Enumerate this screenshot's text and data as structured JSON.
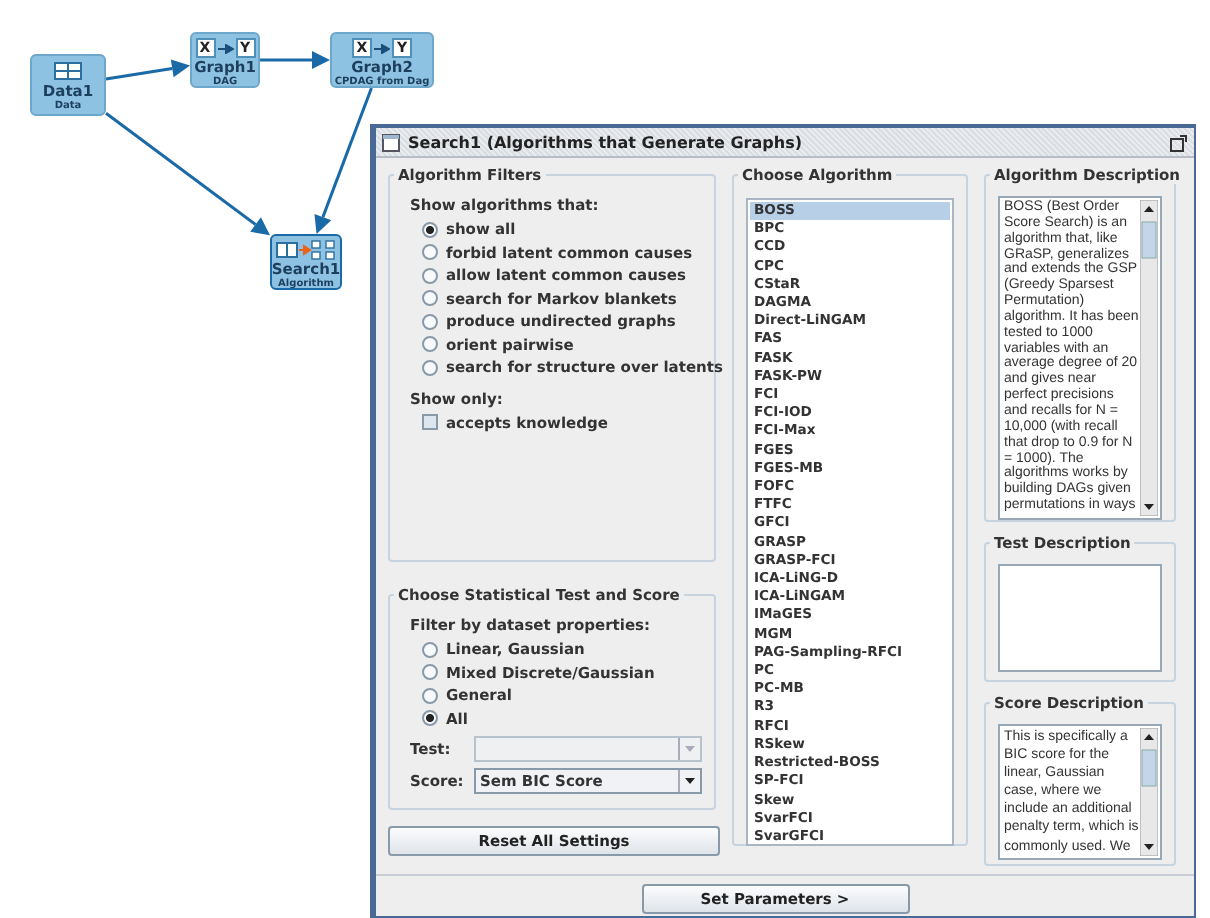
{
  "canvas": {
    "nodes": [
      {
        "name": "Data1",
        "type": "Data",
        "kind": "data"
      },
      {
        "name": "Graph1",
        "type": "DAG",
        "kind": "graph",
        "icon_text": [
          "X",
          "Y"
        ]
      },
      {
        "name": "Graph2",
        "type": "CPDAG from Dag",
        "kind": "graph",
        "icon_text": [
          "X",
          "Y"
        ]
      },
      {
        "name": "Search1",
        "type": "Algorithm",
        "kind": "search",
        "selected": true
      }
    ]
  },
  "dialog": {
    "title": "Search1 (Algorithms that Generate Graphs)",
    "algorithm_filters": {
      "title": "Algorithm Filters",
      "show_label": "Show algorithms that:",
      "options": [
        {
          "label": "show all",
          "selected": true
        },
        {
          "label": "forbid latent common causes",
          "selected": false
        },
        {
          "label": "allow latent common causes",
          "selected": false
        },
        {
          "label": "search for Markov blankets",
          "selected": false
        },
        {
          "label": "produce undirected graphs",
          "selected": false
        },
        {
          "label": "orient pairwise",
          "selected": false
        },
        {
          "label": "search for structure over latents",
          "selected": false
        }
      ],
      "show_only_label": "Show only:",
      "checkboxes": [
        {
          "label": "accepts knowledge",
          "checked": false
        }
      ]
    },
    "test_score": {
      "title": "Choose Statistical Test and Score",
      "filter_label": "Filter by dataset properties:",
      "options": [
        {
          "label": "Linear, Gaussian",
          "selected": false
        },
        {
          "label": "Mixed Discrete/Gaussian",
          "selected": false
        },
        {
          "label": "General",
          "selected": false
        },
        {
          "label": "All",
          "selected": true
        }
      ],
      "test": {
        "label": "Test:",
        "disabled": true
      },
      "score": {
        "label": "Score:",
        "value": "Sem BIC Score",
        "disabled": false
      }
    },
    "reset_button": "Reset All Settings",
    "algorithms": {
      "title": "Choose Algorithm",
      "items": [
        {
          "label": "BOSS",
          "selected": true
        },
        {
          "label": "BPC",
          "selected": false
        },
        {
          "label": "CCD",
          "selected": false
        },
        {
          "label": "CPC",
          "selected": false
        },
        {
          "label": "CStaR",
          "selected": false
        },
        {
          "label": "DAGMA",
          "selected": false
        },
        {
          "label": "Direct-LiNGAM",
          "selected": false
        },
        {
          "label": "FAS",
          "selected": false
        },
        {
          "label": "FASK",
          "selected": false
        },
        {
          "label": "FASK-PW",
          "selected": false
        },
        {
          "label": "FCI",
          "selected": false
        },
        {
          "label": "FCI-IOD",
          "selected": false
        },
        {
          "label": "FCI-Max",
          "selected": false
        },
        {
          "label": "FGES",
          "selected": false
        },
        {
          "label": "FGES-MB",
          "selected": false
        },
        {
          "label": "FOFC",
          "selected": false
        },
        {
          "label": "FTFC",
          "selected": false
        },
        {
          "label": "GFCI",
          "selected": false
        },
        {
          "label": "GRASP",
          "selected": false
        },
        {
          "label": "GRASP-FCI",
          "selected": false
        },
        {
          "label": "ICA-LiNG-D",
          "selected": false
        },
        {
          "label": "ICA-LiNGAM",
          "selected": false
        },
        {
          "label": "IMaGES",
          "selected": false
        },
        {
          "label": "MGM",
          "selected": false
        },
        {
          "label": "PAG-Sampling-RFCI",
          "selected": false
        },
        {
          "label": "PC",
          "selected": false
        },
        {
          "label": "PC-MB",
          "selected": false
        },
        {
          "label": "R3",
          "selected": false
        },
        {
          "label": "RFCI",
          "selected": false
        },
        {
          "label": "RSkew",
          "selected": false
        },
        {
          "label": "Restricted-BOSS",
          "selected": false
        },
        {
          "label": "SP-FCI",
          "selected": false
        },
        {
          "label": "Skew",
          "selected": false
        },
        {
          "label": "SvarFCI",
          "selected": false
        },
        {
          "label": "SvarGFCI",
          "selected": false
        }
      ]
    },
    "algorithm_description": {
      "title": "Algorithm Description",
      "lines": [
        "BOSS (Best Order",
        "Score Search) is an",
        "algorithm that, like",
        "GRaSP, generalizes",
        "and extends the GSP",
        "(Greedy Sparsest",
        "Permutation)",
        "algorithm. It has been",
        "tested to 1000",
        "variables with an",
        "average degree of 20",
        "and gives near",
        "perfect precisions",
        "and recalls for N =",
        "10,000 (with recall",
        "that drop to 0.9 for N",
        "= 1000). The",
        "algorithms works by",
        "building DAGs given",
        "permutations in ways"
      ]
    },
    "test_description": {
      "title": "Test Description"
    },
    "score_description": {
      "title": "Score Description",
      "lines": [
        "This is specifically a",
        "BIC score for the",
        "linear, Gaussian",
        "case, where we",
        "include an additional",
        "penalty term, which is",
        "commonly used. We"
      ]
    },
    "set_parameters_button": "Set Parameters  >"
  }
}
